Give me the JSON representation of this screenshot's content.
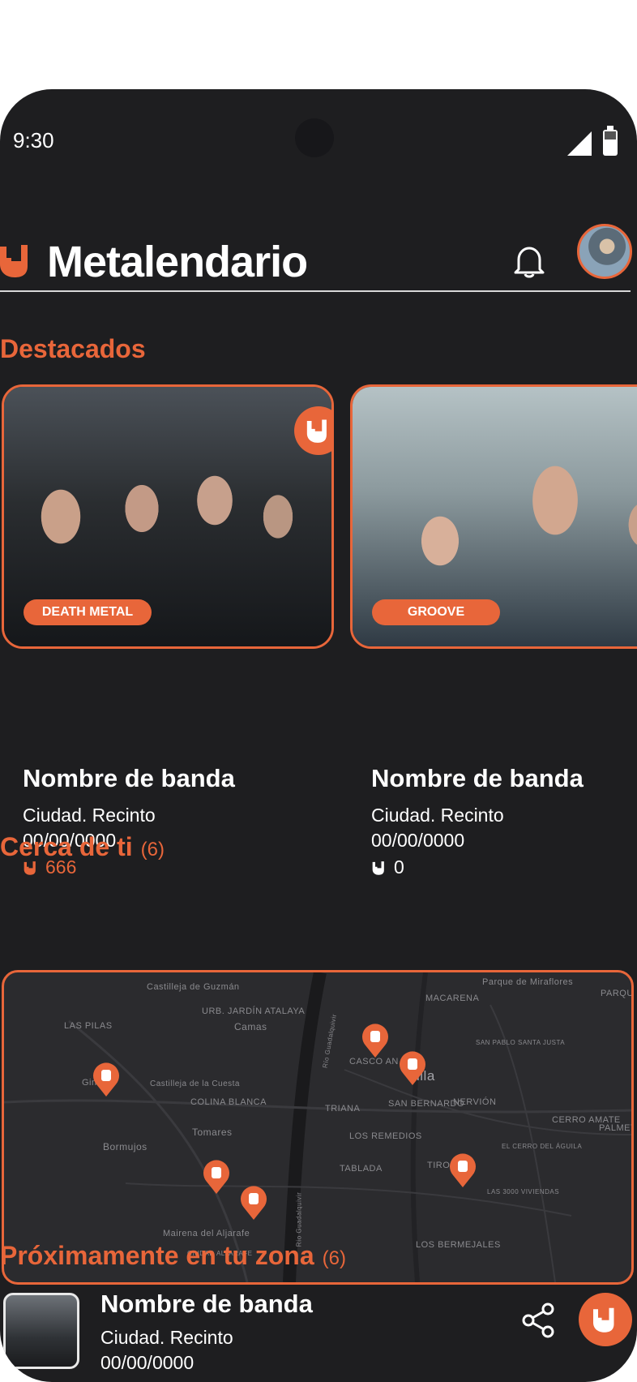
{
  "status_bar": {
    "time": "9:30"
  },
  "header": {
    "title": "Metalendario"
  },
  "featured": {
    "section_title": "Destacados",
    "cards": [
      {
        "band": "Nombre de banda",
        "city_venue": "Ciudad. Recinto",
        "date": "00/00/0000",
        "likes": "666",
        "genre": "DEATH METAL",
        "liked": true
      },
      {
        "band": "Nombre de banda",
        "city_venue": "Ciudad. Recinto",
        "date": "00/00/0000",
        "likes": "0",
        "genre": "GROOVE",
        "liked": false
      }
    ]
  },
  "nearby": {
    "section_title": "Cerca de ti",
    "count": "(6)",
    "map_labels": [
      "Castilleja de Guzmán",
      "LAS PILAS",
      "URB. JARDÍN ATALAYA",
      "Camas",
      "MACARENA",
      "Parque de Miraflores",
      "PARQUE",
      "SAN PABLO SANTA JUSTA",
      "CASCO AN",
      "villa",
      "Gin",
      "Castilleja de la Cuesta",
      "COLINA BLANCA",
      "TRIANA",
      "SAN BERNARDO",
      "NERVIÓN",
      "CERRO AMATE",
      "PALMETE",
      "Tomares",
      "Bormujos",
      "LOS REMEDIOS",
      "EL CERRO DEL ÁGUILA",
      "TABLADA",
      "TIRO",
      "LAS 3000 VIVIENDAS",
      "Mairena del Aljarafe",
      "CIUDAD ALJARAFE",
      "LOS BERMEJALES",
      "Río Guadalquivir",
      "Río Guadalquivir"
    ]
  },
  "upcoming": {
    "section_title": "Próximamente en tu zona",
    "count": "(6)",
    "items": [
      {
        "band": "Nombre de banda",
        "city_venue": "Ciudad. Recinto",
        "date": "00/00/0000"
      }
    ]
  },
  "colors": {
    "accent": "#e8663a",
    "background": "#1e1e20",
    "text": "#ffffff"
  },
  "icons": [
    "rock-hand-icon",
    "bell-icon",
    "map-pin-icon",
    "share-icon"
  ]
}
